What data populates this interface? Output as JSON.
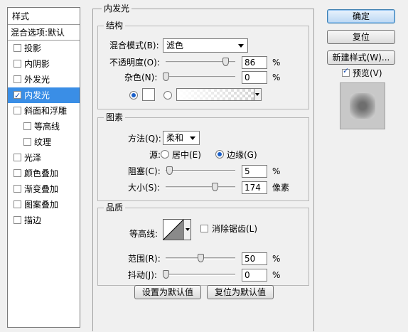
{
  "style_list": {
    "header": "样式",
    "blending_options": "混合选项:默认",
    "items": [
      {
        "label": "投影",
        "checked": false,
        "indent": false,
        "selected": false
      },
      {
        "label": "内阴影",
        "checked": false,
        "indent": false,
        "selected": false
      },
      {
        "label": "外发光",
        "checked": false,
        "indent": false,
        "selected": false
      },
      {
        "label": "内发光",
        "checked": true,
        "indent": false,
        "selected": true
      },
      {
        "label": "斜面和浮雕",
        "checked": false,
        "indent": false,
        "selected": false
      },
      {
        "label": "等高线",
        "checked": false,
        "indent": true,
        "selected": false
      },
      {
        "label": "纹理",
        "checked": false,
        "indent": true,
        "selected": false
      },
      {
        "label": "光泽",
        "checked": false,
        "indent": false,
        "selected": false
      },
      {
        "label": "颜色叠加",
        "checked": false,
        "indent": false,
        "selected": false
      },
      {
        "label": "渐变叠加",
        "checked": false,
        "indent": false,
        "selected": false
      },
      {
        "label": "图案叠加",
        "checked": false,
        "indent": false,
        "selected": false
      },
      {
        "label": "描边",
        "checked": false,
        "indent": false,
        "selected": false
      }
    ]
  },
  "main": {
    "title": "内发光",
    "structure": {
      "title": "结构",
      "blend_mode_label": "混合模式(B):",
      "blend_mode_value": "滤色",
      "opacity_label": "不透明度(O):",
      "opacity_value": "86",
      "opacity_level": 0.86,
      "opacity_unit": "%",
      "noise_label": "杂色(N):",
      "noise_value": "0",
      "noise_level": 0,
      "noise_unit": "%",
      "color_radio_on": true,
      "gradient_radio_on": false
    },
    "elements": {
      "title": "图素",
      "method_label": "方法(Q):",
      "method_value": "柔和",
      "source_label": "源:",
      "source_center": "居中(E)",
      "source_edge": "边缘(G)",
      "source_selected": "edge",
      "choke_label": "阻塞(C):",
      "choke_value": "5",
      "choke_level": 0.05,
      "choke_unit": "%",
      "size_label": "大小(S):",
      "size_value": "174",
      "size_level": 0.7,
      "size_unit": "像素"
    },
    "quality": {
      "title": "品质",
      "contour_label": "等高线:",
      "antialias_label": "消除锯齿(L)",
      "antialias_checked": false,
      "range_label": "范围(R):",
      "range_value": "50",
      "range_level": 0.5,
      "range_unit": "%",
      "jitter_label": "抖动(J):",
      "jitter_value": "0",
      "jitter_level": 0,
      "jitter_unit": "%"
    },
    "make_default": "设置为默认值",
    "reset_default": "复位为默认值"
  },
  "side": {
    "ok": "确定",
    "reset": "复位",
    "new_style": "新建样式(W)...",
    "preview_label": "预览(V)",
    "preview_checked": true
  },
  "colors": {
    "selected_bg": "#3a8ee6",
    "glow_color": "#ffffff"
  }
}
